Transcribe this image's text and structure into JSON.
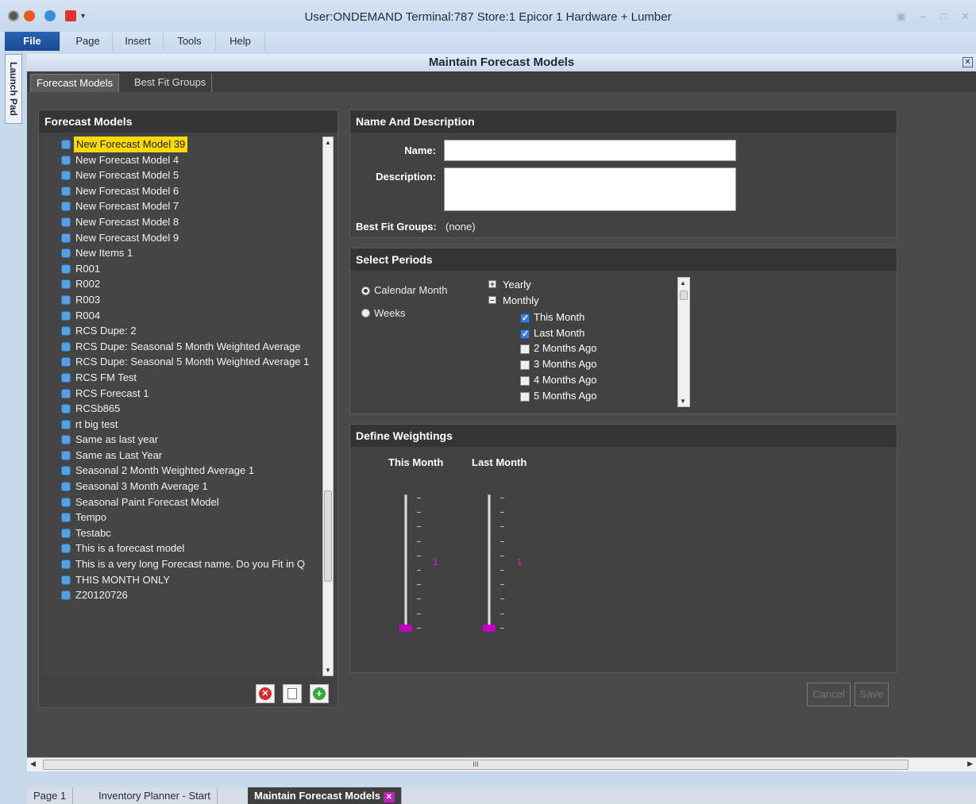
{
  "window": {
    "title": "User:ONDEMAND Terminal:787 Store:1 Epicor 1 Hardware + Lumber"
  },
  "menu": {
    "file": "File",
    "page": "Page",
    "insert": "Insert",
    "tools": "Tools",
    "help": "Help"
  },
  "launchpad": "Launch Pad",
  "main": {
    "title": "Maintain Forecast Models",
    "tabs": [
      "Forecast Models",
      "Best Fit Groups"
    ]
  },
  "models_panel": {
    "title": "Forecast Models",
    "items": [
      "New Forecast Model 39",
      "New Forecast Model 4",
      "New Forecast Model 5",
      "New Forecast Model 6",
      "New Forecast Model 7",
      "New Forecast Model 8",
      "New Forecast Model 9",
      "New Items 1",
      "R001",
      "R002",
      "R003",
      "R004",
      "RCS Dupe: 2",
      "RCS Dupe: Seasonal 5 Month Weighted Average",
      "RCS Dupe: Seasonal 5 Month Weighted Average 1",
      "RCS FM Test",
      "RCS Forecast 1",
      "RCSb865",
      "rt big test",
      "Same as last  year",
      "Same as Last Year",
      "Seasonal 2 Month Weighted Average 1",
      "Seasonal 3 Month Average 1",
      "Seasonal Paint Forecast Model",
      "Tempo",
      "Testabc",
      "This is a forecast model",
      "This is a very long Forecast name. Do you Fit in Q",
      "THIS MONTH ONLY",
      "Z20120726"
    ]
  },
  "name_panel": {
    "title": "Name And Description",
    "name_label": "Name:",
    "name_value": "",
    "desc_label": "Description:",
    "desc_value": "",
    "bestfit_label": "Best Fit Groups:",
    "bestfit_value": "(none)"
  },
  "periods_panel": {
    "title": "Select Periods",
    "radio_calendar": "Calendar Month",
    "radio_weeks": "Weeks",
    "yearly": "Yearly",
    "monthly": "Monthly",
    "months": [
      {
        "label": "This Month",
        "checked": true
      },
      {
        "label": "Last Month",
        "checked": true
      },
      {
        "label": "2 Months Ago",
        "checked": false
      },
      {
        "label": "3 Months Ago",
        "checked": false
      },
      {
        "label": "4 Months Ago",
        "checked": false
      },
      {
        "label": "5 Months Ago",
        "checked": false
      }
    ]
  },
  "weight_panel": {
    "title": "Define Weightings",
    "col1": "This Month",
    "col2": "Last Month",
    "val1": "1",
    "val2": "1"
  },
  "buttons": {
    "cancel": "Cancel",
    "save": "Save"
  },
  "bottom_tabs": [
    "Page 1",
    "Inventory Planner - Start",
    "Maintain Forecast Models"
  ],
  "colors": {
    "selected_highlight": "#f5d90a",
    "slider_accent": "#c000c0"
  }
}
